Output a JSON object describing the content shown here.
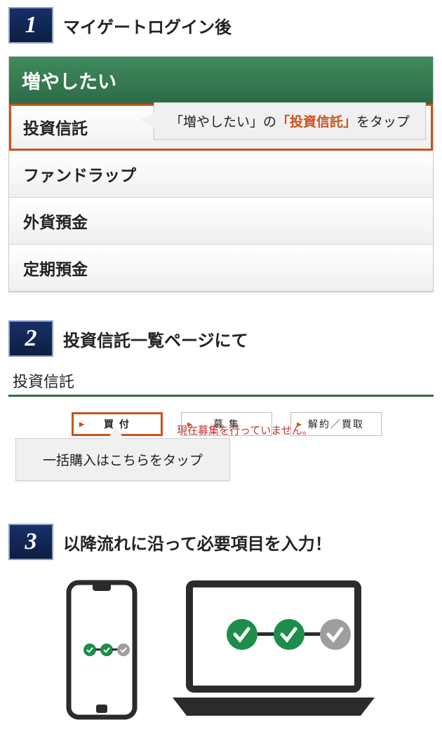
{
  "step1": {
    "number": "1",
    "title": "マイゲートログイン後",
    "menuTitle": "増やしたい",
    "items": [
      "投資信託",
      "ファンドラップ",
      "外貨預金",
      "定期預金"
    ],
    "calloutPrefix": "「増やしたい」の",
    "calloutEm": "「投資信託」",
    "calloutSuffix": "をタップ"
  },
  "step2": {
    "number": "2",
    "title": "投資信託一覧ページにて",
    "paneTitle": "投資信託",
    "tabs": [
      "買 付",
      "募 集",
      "解約／買取"
    ],
    "message": "現在募集を行っていません。",
    "callout": "一括購入はこちらをタップ"
  },
  "step3": {
    "number": "3",
    "title": "以降流れに沿って必要項目を入力！"
  }
}
